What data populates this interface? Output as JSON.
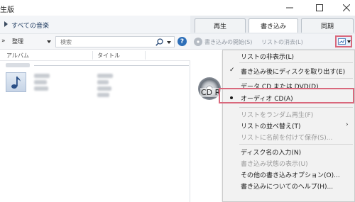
{
  "window": {
    "title_fragment": "生版"
  },
  "nav": {
    "breadcrumb": "すべての音楽"
  },
  "tabs": [
    {
      "label": "再生"
    },
    {
      "label": "書き込み"
    },
    {
      "label": "同期"
    }
  ],
  "toolbar": {
    "organize_label": "整理",
    "search_placeholder": "検索"
  },
  "columns": {
    "album": "アルバム",
    "title": "タイトル"
  },
  "burn": {
    "start_label": "書き込みの開始(S)",
    "clear_label": "リストの消去(L)",
    "disc_label": "CD R"
  },
  "menu": {
    "items": [
      {
        "label": "リストの非表示(L)",
        "state": "normal"
      },
      {
        "label": "書き込み後にディスクを取り出す(E)",
        "state": "checked"
      },
      {
        "label": "データ CD または DVD(D)",
        "state": "normal"
      },
      {
        "label": "オーディオ CD(A)",
        "state": "selected"
      },
      {
        "label": "リストをランダム再生(F)",
        "state": "disabled"
      },
      {
        "label": "リストの並べ替え(T)",
        "state": "submenu"
      },
      {
        "label": "リストに名前を付けて保存(S)...",
        "state": "disabled"
      },
      {
        "label": "ディスク名の入力(N)",
        "state": "normal"
      },
      {
        "label": "書き込み状態の表示(U)",
        "state": "disabled"
      },
      {
        "label": "その他の書き込みオプション(O)...",
        "state": "normal"
      },
      {
        "label": "書き込みについてのヘルプ(H)...",
        "state": "normal"
      }
    ]
  },
  "colors": {
    "highlight_border": "#d9687c",
    "menu_bg": "#f2f2f2",
    "accent": "#2e6fb8"
  },
  "icons": {
    "nav": "chevron-right-icon",
    "search": "search-icon",
    "help": "help-icon",
    "burn_options": "burn-options-icon",
    "album_placeholder": "music-note-icon",
    "disc": "cd-disc-icon"
  }
}
